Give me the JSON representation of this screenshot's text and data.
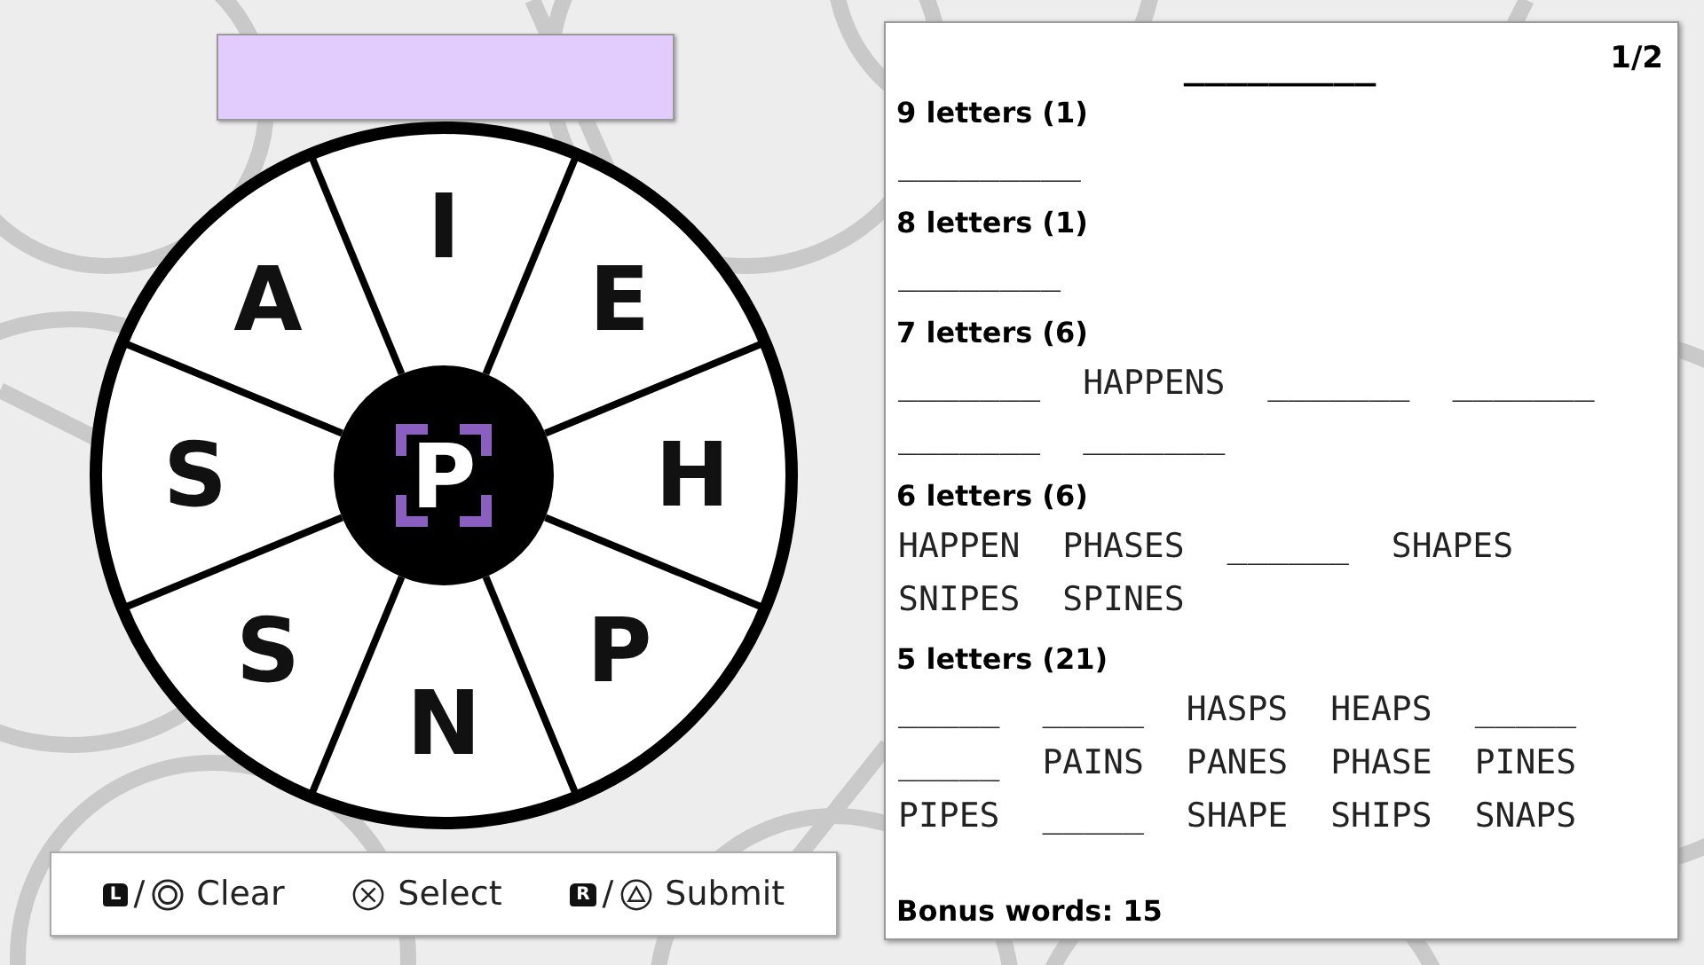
{
  "wheel": {
    "center": {
      "letter": "P",
      "selected": true
    },
    "letters": [
      {
        "letter": "I",
        "selected": false
      },
      {
        "letter": "E",
        "selected": false
      },
      {
        "letter": "H",
        "selected": false
      },
      {
        "letter": "P",
        "selected": false
      },
      {
        "letter": "N",
        "selected": false
      },
      {
        "letter": "S",
        "selected": false
      },
      {
        "letter": "S",
        "selected": false
      },
      {
        "letter": "A",
        "selected": false
      }
    ]
  },
  "controls": [
    {
      "kind": "circle",
      "badge": "L",
      "separator": "/",
      "label": "Clear"
    },
    {
      "kind": "cross",
      "label": "Select"
    },
    {
      "kind": "triangle",
      "badge": "R",
      "separator": "/",
      "label": "Submit"
    }
  ],
  "word_list": {
    "page": "1/2",
    "hint": "_________",
    "groups": [
      {
        "heading": "9 letters (1)",
        "words": [
          "_________"
        ]
      },
      {
        "heading": "8 letters (1)",
        "words": [
          "________"
        ]
      },
      {
        "heading": "7 letters (6)",
        "words": [
          "_______",
          "HAPPENS",
          "_______",
          "_______",
          "_______",
          "_______"
        ]
      },
      {
        "heading": "6 letters (6)",
        "words": [
          "HAPPEN",
          "PHASES",
          "______",
          "SHAPES",
          "SNIPES",
          "SPINES"
        ]
      },
      {
        "heading": "5 letters (21)",
        "words": [
          "_____",
          "_____",
          "HASPS",
          "HEAPS",
          "_____",
          "_____",
          "PAINS",
          "PANES",
          "PHASE",
          "PINES",
          "PIPES",
          "_____",
          "SHAPE",
          "SHIPS",
          "SNAPS"
        ]
      }
    ],
    "bonus": "Bonus words: 15"
  }
}
